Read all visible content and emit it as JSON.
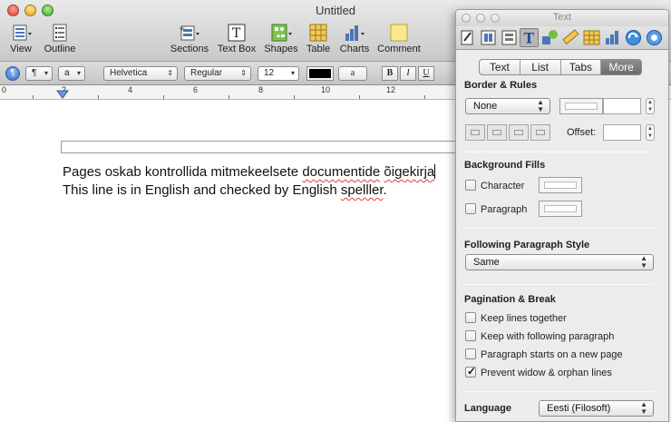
{
  "window": {
    "title": "Untitled"
  },
  "toolbar": {
    "view": "View",
    "outline": "Outline",
    "sections": "Sections",
    "text_box": "Text Box",
    "shapes": "Shapes",
    "table": "Table",
    "charts": "Charts",
    "comment": "Comment"
  },
  "format_bar": {
    "para_style": "¶",
    "char_style": "a",
    "font_family": "Helvetica",
    "font_style": "Regular",
    "font_size": "12",
    "text_color": "#000000",
    "bold": "B",
    "italic": "I",
    "underline": "U"
  },
  "ruler": {
    "numbers": [
      "0",
      "2",
      "4",
      "6",
      "8",
      "10",
      "12"
    ]
  },
  "document": {
    "line1_pre": "Pages oskab kontrollida mitmekeelsete ",
    "line1_sq1": "documentide",
    "line1_mid": " ",
    "line1_sq2": "õigekirja",
    "line2_pre": "This line is in English and checked by English ",
    "line2_sq": "spelller",
    "line2_post": "."
  },
  "inspector": {
    "title": "Text",
    "tabs": [
      "Text",
      "List",
      "Tabs",
      "More"
    ],
    "selected_tab": "More",
    "border_rules": {
      "heading": "Border & Rules",
      "style": "None",
      "offset_label": "Offset:"
    },
    "background_fills": {
      "heading": "Background Fills",
      "character": "Character",
      "paragraph": "Paragraph"
    },
    "following_style": {
      "heading": "Following Paragraph Style",
      "value": "Same"
    },
    "pagination": {
      "heading": "Pagination & Break",
      "keep_lines": "Keep lines together",
      "keep_with_following": "Keep with following paragraph",
      "new_page": "Paragraph starts on a new page",
      "prevent_widow": "Prevent widow & orphan lines",
      "prevent_widow_checked": true
    },
    "language": {
      "label": "Language",
      "value": "Eesti (Filosoft)"
    }
  },
  "colors": {
    "spell_underline": "#e23b3b",
    "selected_tab": "#6c6c6c"
  }
}
